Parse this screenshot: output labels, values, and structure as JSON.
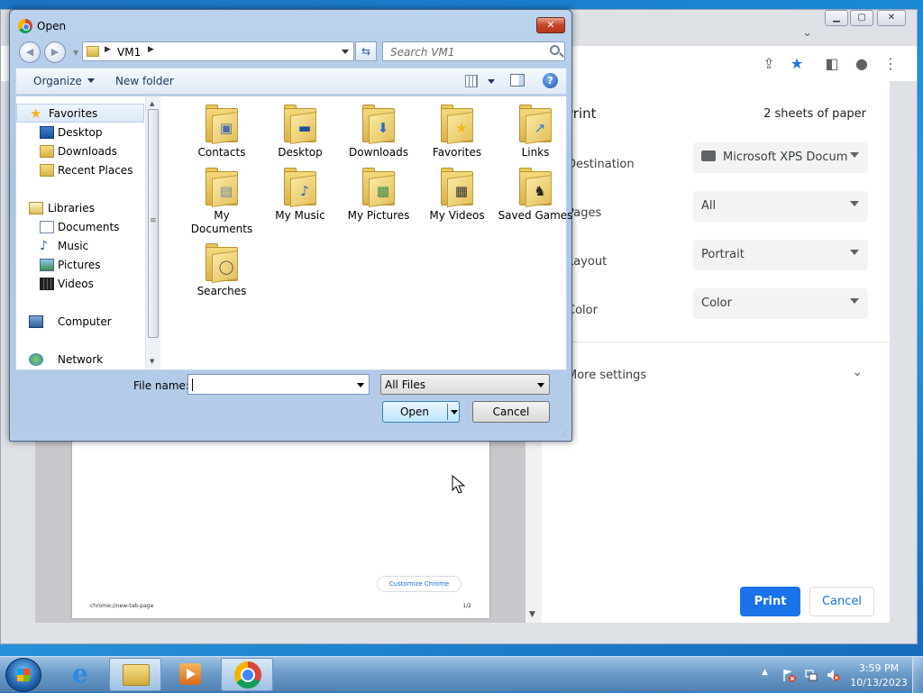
{
  "dialog": {
    "title": "Open",
    "address": {
      "segments": [
        "VM1"
      ]
    },
    "search_placeholder": "Search VM1",
    "toolbar": {
      "organize": "Organize",
      "new_folder": "New folder",
      "help": "?"
    },
    "nav": {
      "favorites": "Favorites",
      "favorites_items": [
        "Desktop",
        "Downloads",
        "Recent Places"
      ],
      "libraries": "Libraries",
      "libraries_items": [
        "Documents",
        "Music",
        "Pictures",
        "Videos"
      ],
      "computer": "Computer",
      "network": "Network"
    },
    "files": [
      {
        "name": "Contacts",
        "icon": "contacts-icon"
      },
      {
        "name": "Desktop",
        "icon": "desktop-icon"
      },
      {
        "name": "Downloads",
        "icon": "download-arrow-icon"
      },
      {
        "name": "Favorites",
        "icon": "star-icon"
      },
      {
        "name": "Links",
        "icon": "link-arrow-icon"
      },
      {
        "name": "My Documents",
        "icon": "document-icon"
      },
      {
        "name": "My Music",
        "icon": "music-note-icon"
      },
      {
        "name": "My Pictures",
        "icon": "picture-icon"
      },
      {
        "name": "My Videos",
        "icon": "film-icon"
      },
      {
        "name": "Saved Games",
        "icon": "chess-piece-icon"
      },
      {
        "name": "Searches",
        "icon": "magnifier-icon"
      }
    ],
    "file_name_label": "File name:",
    "file_name_value": "",
    "file_type": "All Files",
    "open_label": "Open",
    "cancel_label": "Cancel"
  },
  "print": {
    "title": "Print",
    "sheets": "2 sheets of paper",
    "rows": [
      {
        "label": "Destination",
        "value": "Microsoft XPS Docum"
      },
      {
        "label": "Pages",
        "value": "All"
      },
      {
        "label": "Layout",
        "value": "Portrait"
      },
      {
        "label": "Color",
        "value": "Color"
      }
    ],
    "more_settings": "More settings",
    "print_label": "Print",
    "cancel_label": "Cancel",
    "preview": {
      "customize_button": "Customize Chrome",
      "footer_url": "chrome://new-tab-page",
      "footer_page": "1/2"
    }
  },
  "taskbar": {
    "time": "3:59 PM",
    "date": "10/13/2023"
  },
  "colors": {
    "chrome_blue": "#1a73e8",
    "desktop_blue": "#1a86d6"
  }
}
